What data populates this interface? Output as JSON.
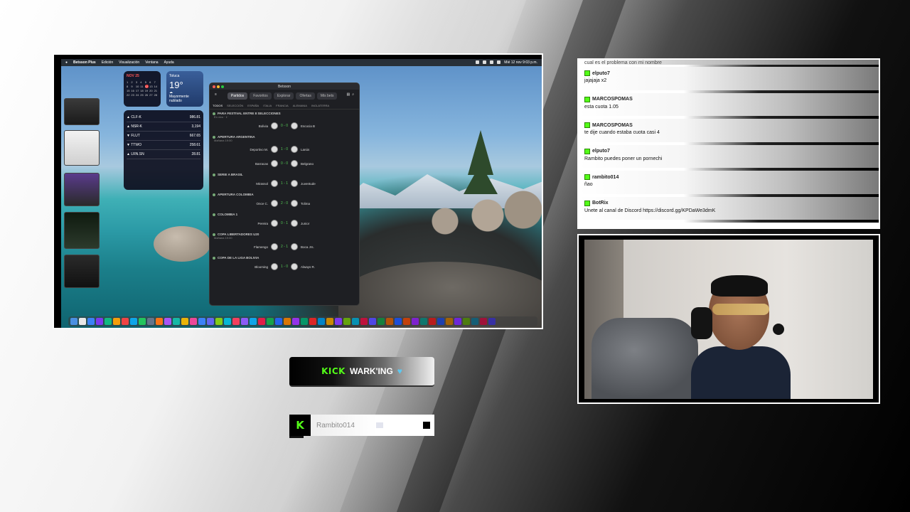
{
  "menubar": {
    "app_name": "Betsson Plus",
    "menus": [
      "Edición",
      "Visualización",
      "Ventana",
      "Ayuda"
    ],
    "clock": "Mié 12 nov  9:03 p.m."
  },
  "widgets": {
    "calendar_month": "NOV 25",
    "weather_city": "Toluca",
    "weather_temp": "19°",
    "weather_desc": "Mayormente nublado",
    "stocks": [
      {
        "symbol": "▲ CLF-K",
        "value": "986.81"
      },
      {
        "symbol": "▲ NSR-K",
        "value": "3,194"
      },
      {
        "symbol": "▼ FLUT",
        "value": "667.65"
      },
      {
        "symbol": "▼ TTWO",
        "value": "258.61"
      },
      {
        "symbol": "▲ LRN.SN",
        "value": "28.81"
      }
    ]
  },
  "bet_app": {
    "title": "Betsson",
    "tabs": [
      "Partidos",
      "Favoritos",
      "Explorar",
      "Ofertas",
      "Mis bets"
    ],
    "league_tabs": [
      "TODOS",
      "SELECCIÓN",
      "ESPAÑA",
      "ITALIA",
      "FRANCIA",
      "ALEMANIA",
      "INGLATERRA"
    ],
    "leagues": [
      {
        "name": "PARA FESTIVAL ENTRE 8 SELECCIONES",
        "sub": "En vivo · 1'",
        "matches": [
          {
            "home": "Bolivia",
            "score": "0 - 0",
            "away": "Escocia B"
          }
        ]
      },
      {
        "name": "APERTURA ARGENTINA",
        "sub": "Mañana 19:00",
        "matches": [
          {
            "home": "Deportivo M.",
            "score": "1 - 0",
            "away": "Lanús"
          },
          {
            "home": "Barracas",
            "score": "0 - 0",
            "away": "Belgrano"
          }
        ]
      },
      {
        "name": "SERIE A BRASIL",
        "sub": "",
        "matches": [
          {
            "home": "Mirassol",
            "score": "1 - 1",
            "away": "Juventude"
          }
        ]
      },
      {
        "name": "APERTURA COLOMBIA",
        "sub": "",
        "matches": [
          {
            "home": "Once C.",
            "score": "2 - 0",
            "away": "Tolima"
          }
        ]
      },
      {
        "name": "COLOMBIA 1",
        "sub": "",
        "matches": [
          {
            "home": "Pereira",
            "score": "0 - 1",
            "away": "Junior"
          }
        ]
      },
      {
        "name": "COPA LIBERTADORES U20",
        "sub": "Mañana 19:00",
        "matches": [
          {
            "home": "Flamengo",
            "score": "2 - 1",
            "away": "Boca Jrs."
          }
        ]
      },
      {
        "name": "COPA DE LA LIGA BOLIVIA",
        "sub": "",
        "matches": [
          {
            "home": "Blooming",
            "score": "1 - 0",
            "away": "Always R."
          }
        ]
      }
    ]
  },
  "chat": {
    "top_line": "cual es el problema con mi nombre",
    "messages": [
      {
        "user": "elputo7",
        "text": "jajajaja x2"
      },
      {
        "user": "MARCOSPOMAS",
        "text": "esta cuota 1.05"
      },
      {
        "user": "MARCOSPOMAS",
        "text": "te dije cuando estaba cuota casi 4"
      },
      {
        "user": "elputo7",
        "text": "Rambito puedes poner un pornechi"
      },
      {
        "user": "rambito014",
        "text": "ñao"
      },
      {
        "user": "BotRix",
        "text": "Unete al canal de Discord https://discord.gg/KPDaWe3dmK"
      }
    ],
    "badge_color": "#53fc18"
  },
  "overlay": {
    "kick_word": "KICK",
    "team_name": "WARK'ING",
    "heart": "♥",
    "kick_logo_letter": "K",
    "username": "Rambito014",
    "accent_green": "#53fc18"
  }
}
